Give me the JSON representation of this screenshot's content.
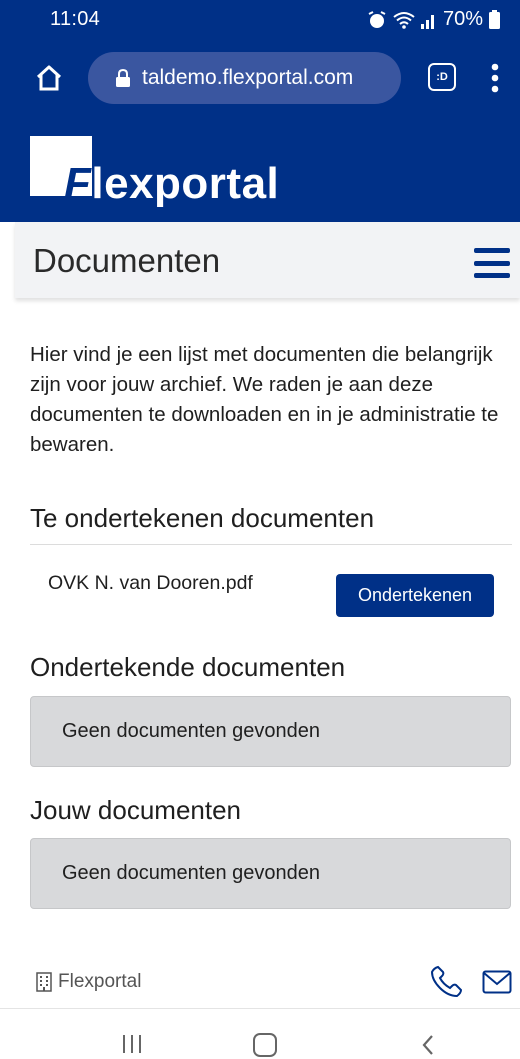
{
  "status_bar": {
    "time": "11:04",
    "battery": "70%"
  },
  "browser": {
    "url": "taldemo.flexportal.com",
    "tab_label": ":D"
  },
  "site": {
    "logo_text": "lexportal",
    "logo_initial": "F",
    "brand_color": "#003087"
  },
  "page": {
    "title": "Documenten",
    "intro": "Hier vind je een lijst met documenten die belangrijk zijn voor jouw archief. We raden je aan deze documenten te downloaden en in je administratie te bewaren."
  },
  "sections": {
    "to_sign": {
      "title": "Te ondertekenen documenten",
      "documents": [
        {
          "name": "OVK N. van Dooren.pdf",
          "action_label": "Ondertekenen"
        }
      ]
    },
    "signed": {
      "title": "Ondertekende documenten",
      "empty_message": "Geen documenten gevonden"
    },
    "yours": {
      "title": "Jouw documenten",
      "empty_message": "Geen documenten gevonden"
    }
  },
  "footer": {
    "brand": "Flexportal",
    "icons": [
      "building-icon",
      "phone-icon",
      "mail-icon"
    ]
  }
}
